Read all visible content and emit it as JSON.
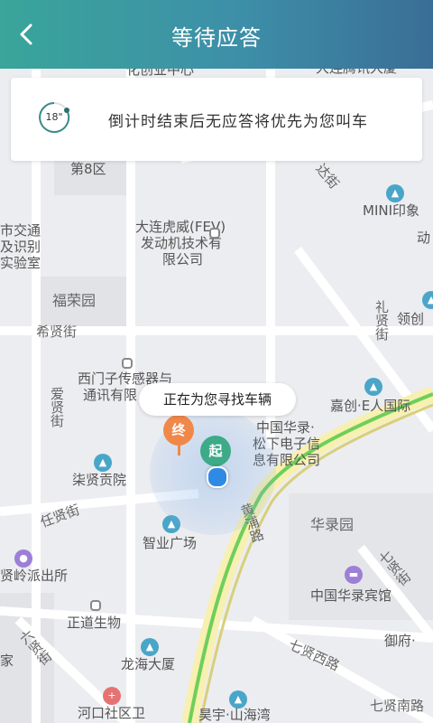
{
  "header": {
    "title": "等待应答",
    "back_icon": "chevron-left-icon"
  },
  "banner": {
    "timer": "18\"",
    "message": "倒计时结束后无应答将优先为您叫车"
  },
  "bubble": {
    "text": "正在为您寻找车辆"
  },
  "pins": {
    "end": "终",
    "start": "起"
  },
  "map_labels": {
    "top_partial_1": "化创业中心",
    "top_partial_2": "大连腾讯大厦",
    "area_8": "第8区",
    "street_da": "达街",
    "mini": "MINI印象",
    "dong": "动",
    "fev_1": "大连虎威(FEV)",
    "fev_2": "发动机技术有",
    "fev_3": "限公司",
    "traffic_1": "市交通",
    "traffic_2": "及识别",
    "traffic_3": "实验室",
    "furong": "福荣园",
    "lixian": "礼贤街",
    "lingchuang": "领创",
    "xixian": "希贤街",
    "ximenzi_1": "西门子传感器与",
    "ximenzi_2": "通讯有限",
    "aixian": "爱贤街",
    "jiachuang": "嘉创·E人国际",
    "huailu_1": "中国华录·",
    "huailu_2": "松下电子信",
    "huailu_3": "息有限公司",
    "qixian_yuan": "柒贤贡院",
    "huangpu": "黄浦路",
    "renxian": "任贤街",
    "zhiye": "智业广场",
    "hualu_yuan": "华录园",
    "qixian_jie": "七贤街",
    "xianling": "贤岭派出所",
    "hualu_hotel": "中国华录宾馆",
    "zhengdao": "正道生物",
    "yufu": "御府·",
    "liuxian": "六贤街",
    "jia": "家",
    "qixian_xilu": "七贤西路",
    "longhai": "龙海大厦",
    "hekou": "河口社区卫",
    "haoyu": "昊宇·山海湾",
    "qixian_nanlu": "七贤南路"
  },
  "colors": {
    "header_start": "#3aa59a",
    "header_end": "#3a6e96",
    "end_pin": "#f0884a",
    "start_pin": "#3daa88",
    "location": "#2f8ae5"
  }
}
